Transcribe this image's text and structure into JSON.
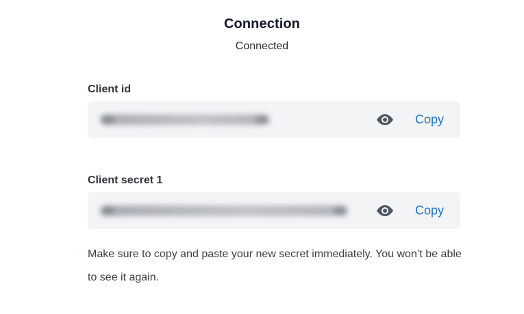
{
  "header": {
    "title": "Connection",
    "status": "Connected"
  },
  "fields": [
    {
      "label": "Client id",
      "value_masked": true,
      "copy_label": "Copy",
      "toggle_icon": "eye-icon"
    },
    {
      "label": "Client secret 1",
      "value_masked": true,
      "copy_label": "Copy",
      "toggle_icon": "eye-icon"
    }
  ],
  "note": {
    "text": "Make sure to copy and paste your new secret immediately. You won’t be able to see it again."
  },
  "colors": {
    "accent": "#1E74C6",
    "field_background": "#F3F4F6",
    "icon": "#4B5563",
    "text": "#1F2328",
    "muted_text": "#3A3F46"
  }
}
